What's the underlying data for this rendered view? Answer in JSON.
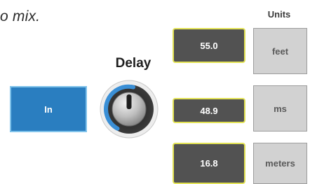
{
  "caption": "o mix.",
  "units_header": "Units",
  "delay": {
    "title": "Delay",
    "in_button": "In"
  },
  "rows": [
    {
      "value": "55.0",
      "unit": "feet"
    },
    {
      "value": "48.9",
      "unit": "ms"
    },
    {
      "value": "16.8",
      "unit": "meters"
    }
  ],
  "colors": {
    "in_button": "#2a7ec0",
    "value_box": "#525252",
    "value_border": "#e2e254",
    "unit_box": "#d2d2d2"
  }
}
